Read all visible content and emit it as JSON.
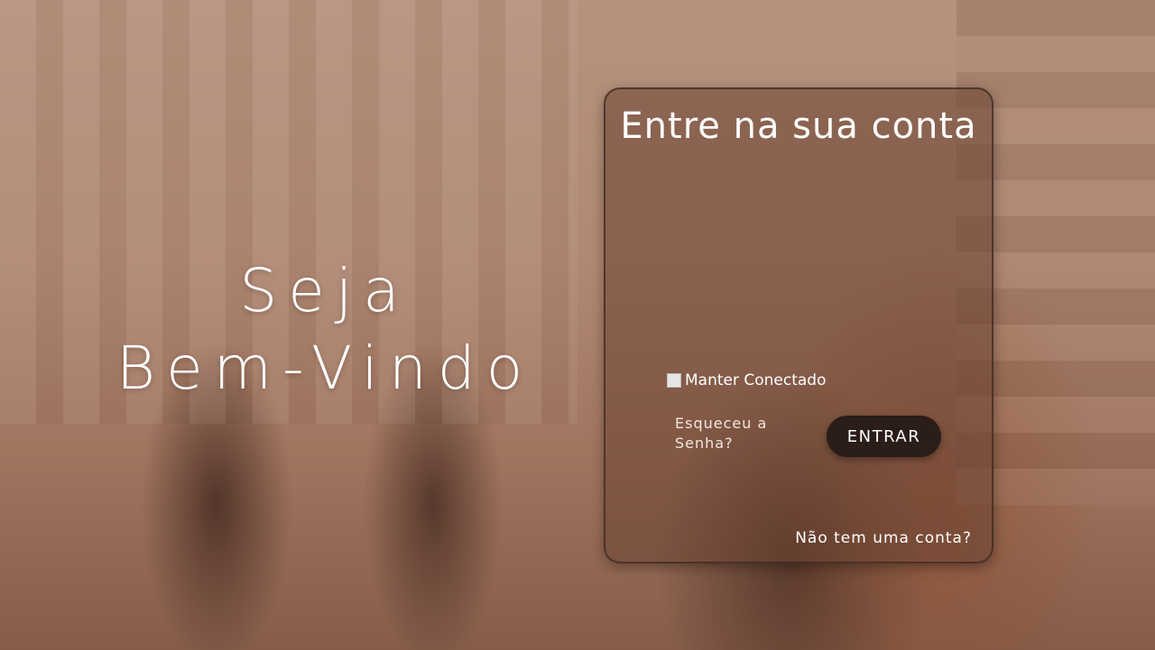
{
  "welcome": {
    "line1": "Seja",
    "line2": "Bem-Vindo"
  },
  "login_card": {
    "title": "Entre na sua conta",
    "remember_label": "Manter Conectado",
    "remember_checked": false,
    "forgot_password": "Esqueceu a Senha?",
    "submit_label": "ENTRAR",
    "signup_link": "Não tem uma conta?"
  },
  "colors": {
    "button_bg": "#2b1d19",
    "card_overlay": "#69413280"
  }
}
